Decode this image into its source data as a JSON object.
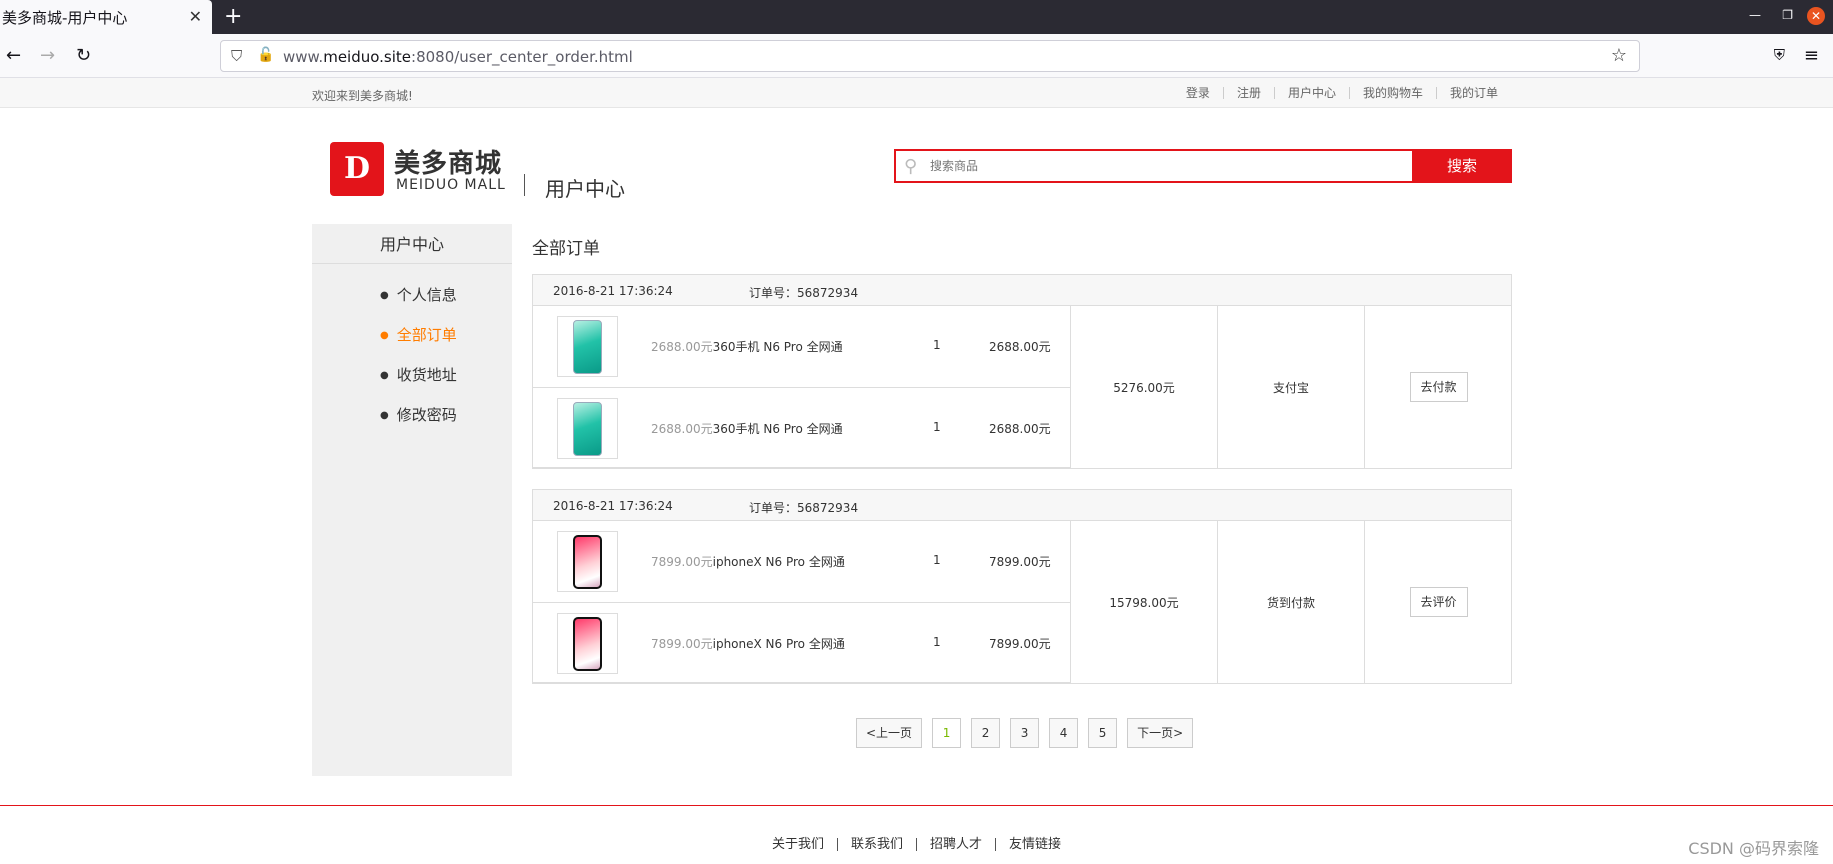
{
  "browser": {
    "tab_title": "美多商城-用户中心",
    "tab_close": "✕",
    "new_tab": "+",
    "url_host_prefix": "www.",
    "url_host_main": "meiduo.site",
    "url_rest": ":8080/user_center_order.html"
  },
  "topbar": {
    "welcome": "欢迎来到美多商城!",
    "links": [
      "登录",
      "注册",
      "用户中心",
      "我的购物车",
      "我的订单"
    ]
  },
  "header": {
    "logo_mark": "D",
    "logo_cn": "美多商城",
    "logo_en": "MEIDUO MALL",
    "subtitle": "用户中心",
    "search_placeholder": "搜索商品",
    "search_button": "搜索"
  },
  "sidebar": {
    "title": "用户中心",
    "items": [
      {
        "label": "个人信息",
        "active": false
      },
      {
        "label": "全部订单",
        "active": true
      },
      {
        "label": "收货地址",
        "active": false
      },
      {
        "label": "修改密码",
        "active": false
      }
    ]
  },
  "main": {
    "title": "全部订单",
    "orders": [
      {
        "time": "2016-8-21 17:36:24",
        "order_no": "订单号：56872934",
        "goods": [
          {
            "price": "2688.00元",
            "name": "360手机 N6 Pro 全网通",
            "count": "1",
            "total": "2688.00元",
            "image": "green-phone"
          },
          {
            "price": "2688.00元",
            "name": "360手机 N6 Pro 全网通",
            "count": "1",
            "total": "2688.00元",
            "image": "green-phone"
          }
        ],
        "amount": "5276.00元",
        "payment": "支付宝",
        "action": "去付款"
      },
      {
        "time": "2016-8-21 17:36:24",
        "order_no": "订单号：56872934",
        "goods": [
          {
            "price": "7899.00元",
            "name": "iphoneX N6 Pro 全网通",
            "count": "1",
            "total": "7899.00元",
            "image": "iphonex"
          },
          {
            "price": "7899.00元",
            "name": "iphoneX N6 Pro 全网通",
            "count": "1",
            "total": "7899.00元",
            "image": "iphonex"
          }
        ],
        "amount": "15798.00元",
        "payment": "货到付款",
        "action": "去评价"
      }
    ]
  },
  "pager": {
    "prev": "<上一页",
    "pages": [
      "1",
      "2",
      "3",
      "4",
      "5"
    ],
    "current": "1",
    "next": "下一页>"
  },
  "footer": {
    "links": [
      "关于我们",
      "联系我们",
      "招聘人才",
      "友情链接"
    ],
    "watermark": "CSDN @码界索隆"
  },
  "colors": {
    "brand": "#e3141a",
    "active": "#ff7d00",
    "current_page": "#79b900"
  }
}
